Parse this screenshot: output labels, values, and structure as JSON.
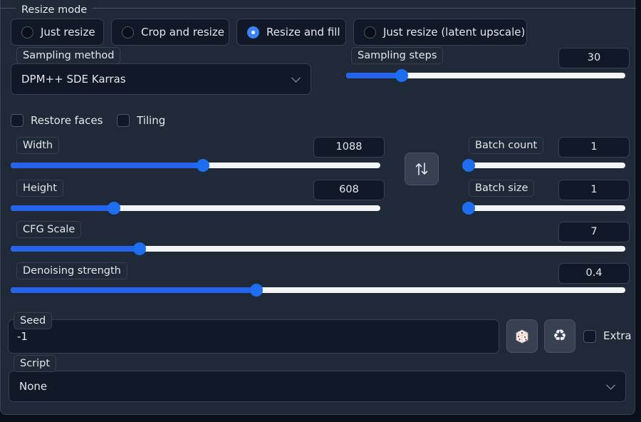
{
  "resize_mode": {
    "label": "Resize mode",
    "options": [
      "Just resize",
      "Crop and resize",
      "Resize and fill",
      "Just resize (latent upscale)"
    ],
    "selected": "Resize and fill"
  },
  "sampling_method": {
    "label": "Sampling method",
    "value": "DPM++ SDE Karras"
  },
  "sampling_steps": {
    "label": "Sampling steps",
    "value": "30",
    "fraction": 0.2
  },
  "restore_faces": {
    "label": "Restore faces",
    "checked": false
  },
  "tiling": {
    "label": "Tiling",
    "checked": false
  },
  "width": {
    "label": "Width",
    "value": "1088",
    "fraction": 0.52
  },
  "height": {
    "label": "Height",
    "value": "608",
    "fraction": 0.28
  },
  "swap_icon": "swap-vertical-arrows-icon",
  "batch_count": {
    "label": "Batch count",
    "value": "1",
    "fraction": 0.0
  },
  "batch_size": {
    "label": "Batch size",
    "value": "1",
    "fraction": 0.0
  },
  "cfg_scale": {
    "label": "CFG Scale",
    "value": "7",
    "fraction": 0.21
  },
  "denoising_strength": {
    "label": "Denoising strength",
    "value": "0.4",
    "fraction": 0.4
  },
  "seed": {
    "label": "Seed",
    "value": "-1",
    "dice_icon": "dice-icon",
    "reuse_icon": "recycle-icon"
  },
  "extra": {
    "label": "Extra",
    "checked": false
  },
  "script": {
    "label": "Script",
    "value": "None"
  },
  "colors": {
    "accent": "#2563eb",
    "panel": "#1f2937",
    "input_bg": "#111827",
    "border": "#374151"
  }
}
